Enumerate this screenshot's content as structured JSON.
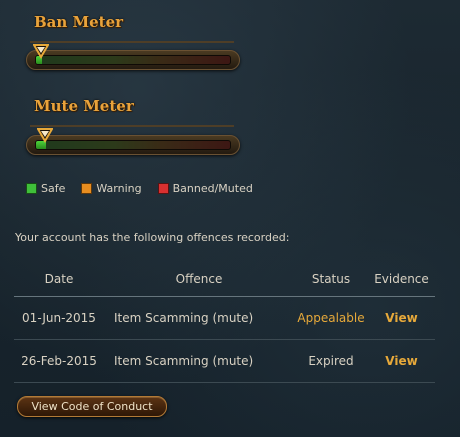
{
  "ban_meter": {
    "title": "Ban Meter",
    "level": 0.02
  },
  "mute_meter": {
    "title": "Mute Meter",
    "level": 0.05
  },
  "legend": [
    {
      "label": "Safe",
      "color": "#3fc03a"
    },
    {
      "label": "Warning",
      "color": "#e88d1f"
    },
    {
      "label": "Banned/Muted",
      "color": "#d93030"
    }
  ],
  "intro_text": "Your account has the following offences recorded:",
  "table": {
    "headers": {
      "date": "Date",
      "offence": "Offence",
      "status": "Status",
      "evidence": "Evidence"
    },
    "rows": [
      {
        "date": "01-Jun-2015",
        "offence": "Item Scamming (mute)",
        "status": "Appealable",
        "evidence": "View"
      },
      {
        "date": "26-Feb-2015",
        "offence": "Item Scamming (mute)",
        "status": "Expired",
        "evidence": "View"
      }
    ]
  },
  "cta_label": "View Code of Conduct",
  "colors": {
    "accent": "#e7a93a",
    "title": "#e9a33b"
  }
}
